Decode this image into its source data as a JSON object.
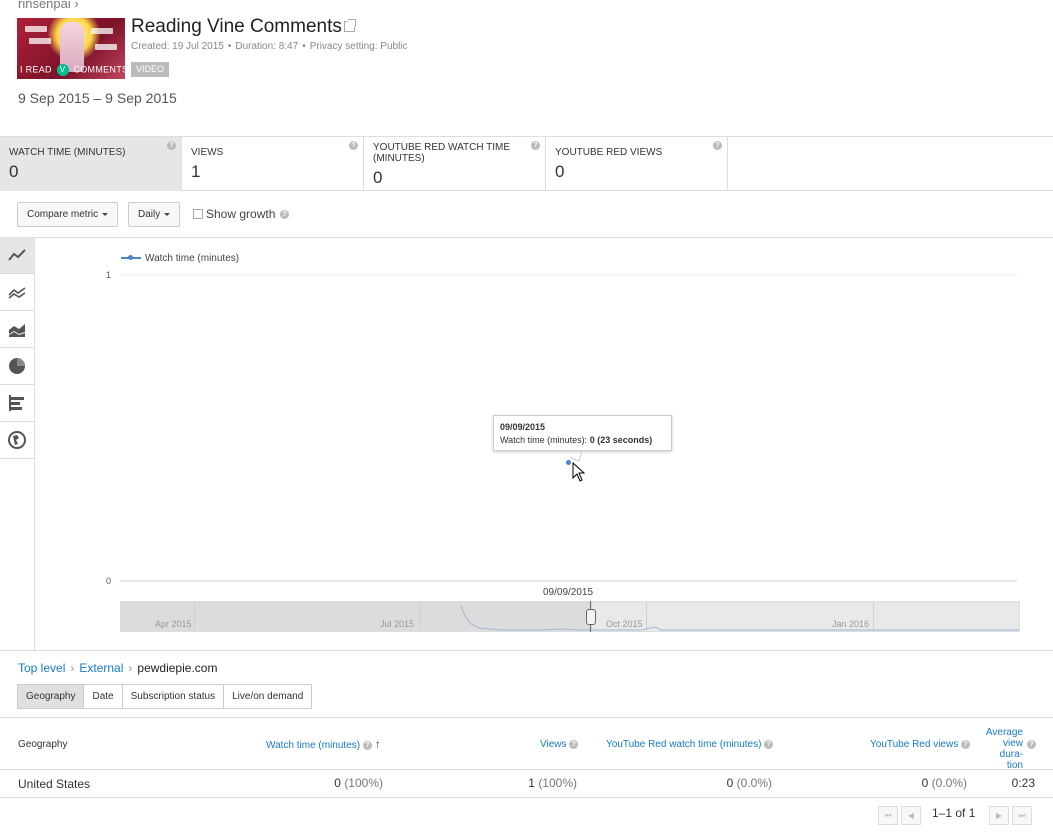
{
  "header": {
    "owner_breadcrumb": "rinsenpai ›",
    "video_title": "Reading Vine Comments",
    "created": "Created: 19 Jul 2015",
    "duration": "Duration: 8:47",
    "privacy": "Privacy setting: Public",
    "meta_sep": "•",
    "type_badge": "VIDEO",
    "thumbnail_caption_left": "I READ",
    "thumbnail_caption_logo": "V",
    "thumbnail_caption_right": "COMMENTS",
    "date_range": "9 Sep 2015 – 9 Sep 2015"
  },
  "metrics": [
    {
      "label": "WATCH TIME (MINUTES)",
      "value": "0",
      "selected": true
    },
    {
      "label": "VIEWS",
      "value": "1",
      "selected": false
    },
    {
      "label": "YOUTUBE RED WATCH TIME (MINUTES)",
      "value": "0",
      "selected": false
    },
    {
      "label": "YOUTUBE RED VIEWS",
      "value": "0",
      "selected": false
    }
  ],
  "help_glyph": "?",
  "controls": {
    "compare_metric": "Compare metric",
    "granularity": "Daily",
    "show_growth": "Show growth"
  },
  "chart_tools": [
    "line-chart-icon",
    "multi-line-chart-icon",
    "stacked-area-chart-icon",
    "pie-chart-icon",
    "bar-chart-icon",
    "globe-map-icon"
  ],
  "chart_data": {
    "type": "line",
    "series": [
      {
        "name": "Watch time (minutes)",
        "x": [
          "09/09/2015"
        ],
        "values": [
          0
        ]
      }
    ],
    "ylim": [
      0,
      1
    ],
    "yticks": [
      "1",
      "0"
    ],
    "color": "#4b84c6",
    "legend": "top-left",
    "tooltip": {
      "date": "09/09/2015",
      "label": "Watch time (minutes): ",
      "value": "0 (23 seconds)"
    },
    "navigator": {
      "date_label": "09/09/2015",
      "months": [
        "Apr 2015",
        "Jul 2015",
        "Oct 2015",
        "Jan 2016"
      ]
    }
  },
  "breadcrumb": {
    "items": [
      "Top level",
      "External"
    ],
    "current": "pewdiepie.com",
    "sep": "›"
  },
  "dimension_tabs": [
    {
      "label": "Geography",
      "selected": true
    },
    {
      "label": "Date",
      "selected": false
    },
    {
      "label": "Subscription status",
      "selected": false
    },
    {
      "label": "Live/on demand",
      "selected": false
    }
  ],
  "table": {
    "headers": {
      "geography": "Geography",
      "watch_time": "Watch time (minutes)",
      "sort_arrow": "↑",
      "views": "Views",
      "red_watch_time": "YouTube Red watch time (minutes)",
      "red_views": "YouTube Red views",
      "avg_duration_1": "Average",
      "avg_duration_2": "view dura-",
      "avg_duration_3": "tion"
    },
    "rows": [
      {
        "geography": "United States",
        "watch_time": "0",
        "watch_time_pct": "(100%)",
        "views": "1",
        "views_pct": "(100%)",
        "red_watch_time": "0",
        "red_watch_time_pct": "(0.0%)",
        "red_views": "0",
        "red_views_pct": "(0.0%)",
        "avg_duration": "0:23"
      }
    ]
  },
  "pager": {
    "label": "1–1 of 1",
    "first": "⏮",
    "prev": "◀",
    "next": "▶",
    "last": "⏭"
  }
}
